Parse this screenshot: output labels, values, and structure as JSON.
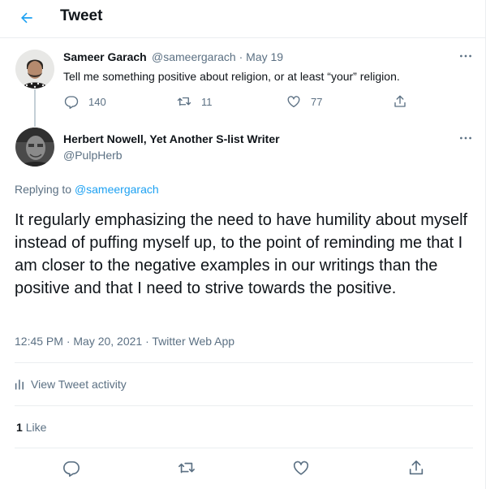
{
  "header": {
    "title": "Tweet"
  },
  "original_tweet": {
    "author_name": "Sameer Garach",
    "handle": "@sameergarach",
    "date": "May 19",
    "text": "Tell me something positive about religion, or at least “your” religion.",
    "replies": "140",
    "retweets": "11",
    "likes": "77"
  },
  "main_tweet": {
    "author_name": "Herbert Nowell, Yet Another S-list Writer",
    "handle": "@PulpHerb",
    "replying_label": "Replying to",
    "replying_to": "@sameergarach",
    "text": "It regularly emphasizing the need to have humility about myself instead of puffing myself up, to the point of reminding me that I am closer to the negative examples in our writings than the positive and that I need to strive towards the positive.",
    "timestamp": "12:45 PM · May 20, 2021 · Twitter Web App",
    "activity_label": "View Tweet activity",
    "likes_count": "1",
    "likes_label": "Like"
  },
  "colors": {
    "accent": "#1da1f2",
    "muted": "#5b7083",
    "text": "#0f1419",
    "divider": "#ebeef0"
  },
  "icons": [
    "back-arrow-icon",
    "more-icon",
    "reply-icon",
    "retweet-icon",
    "like-icon",
    "share-icon",
    "activity-icon"
  ]
}
